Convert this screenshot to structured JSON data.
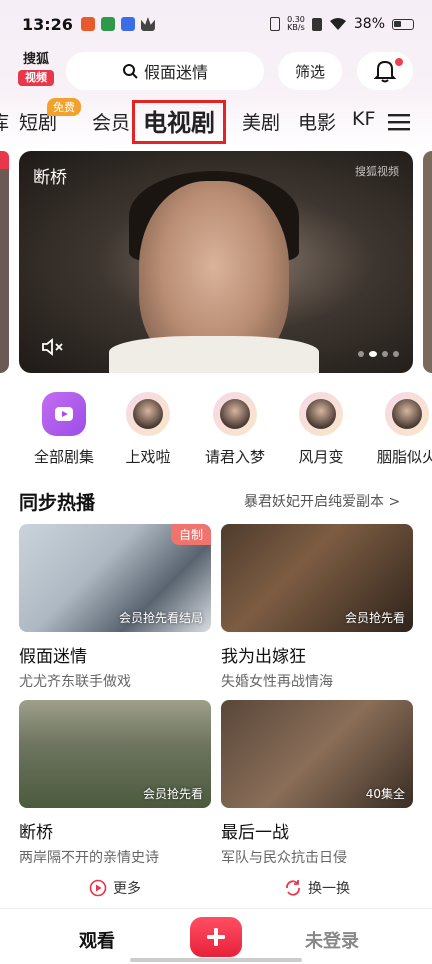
{
  "status_bar": {
    "time": "13:26",
    "net_speed": "0.30\nKB/s",
    "battery": "38%"
  },
  "header": {
    "logo_top": "搜狐",
    "logo_bottom": "视频",
    "search_placeholder": "假面迷情",
    "filter_label": "筛选"
  },
  "tabs": [
    {
      "label": "库"
    },
    {
      "label": "短剧",
      "badge": "免费"
    },
    {
      "label": "会员"
    },
    {
      "label": "电视剧",
      "active": true
    },
    {
      "label": "美剧"
    },
    {
      "label": "电影"
    },
    {
      "label": "KF"
    }
  ],
  "hero": {
    "title": "断桥",
    "watermark": "搜狐视频"
  },
  "categories": [
    {
      "label": "全部剧集"
    },
    {
      "label": "上戏啦"
    },
    {
      "label": "请君入梦"
    },
    {
      "label": "风月变"
    },
    {
      "label": "胭脂似火"
    }
  ],
  "section": {
    "title": "同步热播",
    "more": "暴君妖妃开启纯爱副本 >"
  },
  "cards": [
    {
      "name": "假面迷情",
      "sub": "尤尤齐东联手做戏",
      "corner": "自制",
      "label": "会员抢先看结局"
    },
    {
      "name": "我为出嫁狂",
      "sub": "失婚女性再战情海",
      "corner": "",
      "label": "会员抢先看"
    },
    {
      "name": "断桥",
      "sub": "两岸隔不开的亲情史诗",
      "corner": "",
      "label": "会员抢先看"
    },
    {
      "name": "最后一战",
      "sub": "军队与民众抗击日侵",
      "corner": "",
      "label": "40集全"
    }
  ],
  "footer_actions": {
    "more": "更多",
    "refresh": "换一换"
  },
  "bottom_nav": {
    "watch": "观看",
    "login": "未登录"
  },
  "colors": {
    "accent": "#e8374a",
    "tab_highlight_border": "#e22424",
    "badge": "#f2a22a"
  }
}
